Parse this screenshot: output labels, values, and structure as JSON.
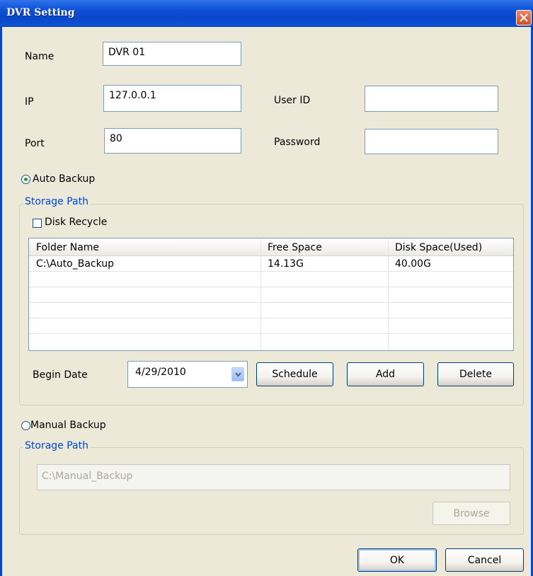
{
  "window": {
    "title": "DVR Setting"
  },
  "fields": {
    "name_label": "Name",
    "name_value": "DVR 01",
    "ip_label": "IP",
    "ip_value": "127.0.0.1",
    "port_label": "Port",
    "port_value": "80",
    "userid_label": "User ID",
    "userid_value": "",
    "password_label": "Password",
    "password_value": ""
  },
  "auto_backup": {
    "label": "Auto Backup",
    "selected": true,
    "storage_path_legend": "Storage Path",
    "disk_recycle_label": "Disk Recycle",
    "disk_recycle_checked": false,
    "columns": [
      "Folder Name",
      "Free Space",
      "Disk Space(Used)"
    ],
    "rows": [
      {
        "folder": "C:\\Auto_Backup",
        "free": "14.13G",
        "used": "40.00G"
      }
    ],
    "begin_date_label": "Begin Date",
    "begin_date_value": "4/29/2010",
    "buttons": {
      "schedule": "Schedule",
      "add": "Add",
      "delete": "Delete"
    }
  },
  "manual_backup": {
    "label": "Manual Backup",
    "selected": false,
    "storage_path_legend": "Storage Path",
    "path_value": "C:\\Manual_Backup",
    "browse_label": "Browse"
  },
  "footer": {
    "ok_label": "OK",
    "cancel_label": "Cancel"
  },
  "colors": {
    "title_bar": "#0a46c8",
    "legend_text": "#0046d5",
    "dialog_bg": "#ece9d8"
  },
  "icons": {
    "close": "close-icon",
    "dropdown": "chevron-down-icon"
  }
}
